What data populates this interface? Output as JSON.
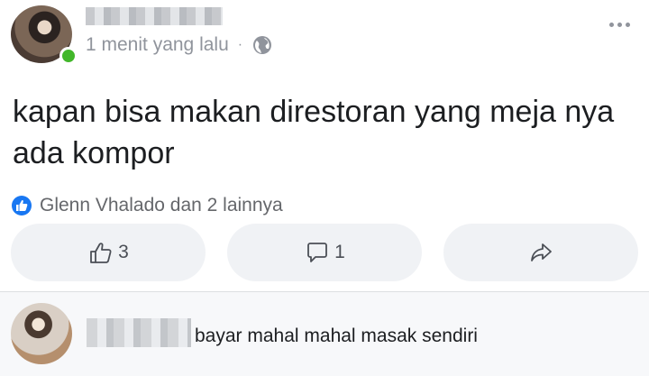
{
  "post": {
    "author_name": "",
    "time": "1 menit yang lalu",
    "separator": "·",
    "privacy_icon": "globe-icon",
    "text": "kapan bisa makan direstoran yang meja nya ada kompor"
  },
  "reactions": {
    "icon": "like-badge-icon",
    "summary": "Glenn Vhalado dan 2 lainnya"
  },
  "actions": {
    "like_count": "3",
    "comment_count": "1",
    "share_icon": "share-icon"
  },
  "comment": {
    "author_name": "",
    "text": "bayar mahal mahal masak sendiri"
  },
  "colors": {
    "accent": "#1877f2",
    "online": "#42b72a",
    "button_bg": "#f0f2f5",
    "muted_text": "#90949c"
  }
}
